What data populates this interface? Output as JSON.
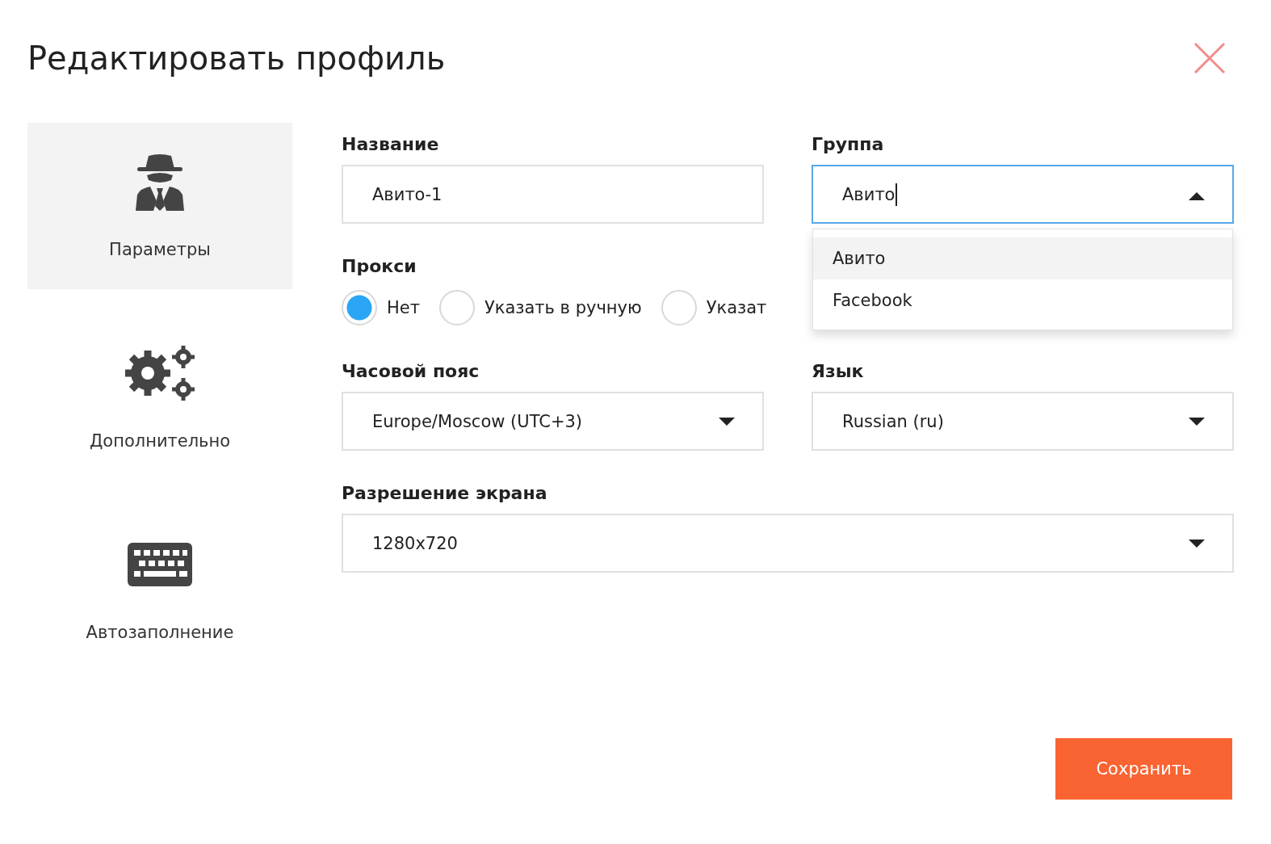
{
  "title": "Редактировать профиль",
  "sidebar": {
    "items": [
      {
        "label": "Параметры",
        "selected": true,
        "kind": "spy"
      },
      {
        "label": "Дополнительно",
        "selected": false,
        "kind": "gears"
      },
      {
        "label": "Автозаполнение",
        "selected": false,
        "kind": "keyboard"
      }
    ]
  },
  "name": {
    "label": "Название",
    "value": "Авито-1"
  },
  "group": {
    "label": "Группа",
    "value": "Авито",
    "focused": true,
    "expanded": true,
    "options": [
      {
        "label": "Авито",
        "selected": true
      },
      {
        "label": "Facebook",
        "selected": false
      }
    ]
  },
  "proxy": {
    "label": "Прокси",
    "options": [
      {
        "label": "Нет",
        "selected": true
      },
      {
        "label": "Указать в ручную",
        "selected": false
      },
      {
        "label": "Указат",
        "selected": false
      }
    ]
  },
  "timezone": {
    "label": "Часовой пояс",
    "value": "Europe/Moscow (UTC+3)"
  },
  "language": {
    "label": "Язык",
    "value": "Russian (ru)"
  },
  "resolution": {
    "label": "Разрешение экрана",
    "value": "1280x720"
  },
  "save_button": "Сохранить"
}
